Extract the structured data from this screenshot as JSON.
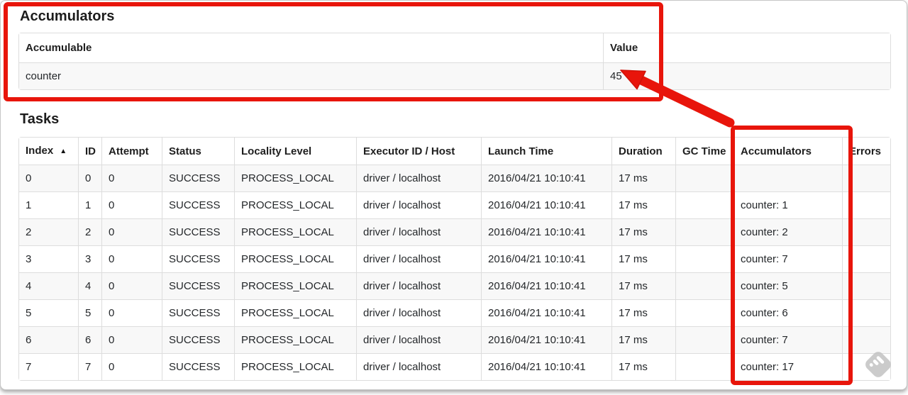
{
  "colors": {
    "highlight_red": "#e8150b",
    "stripe_grey": "#f8f8f8",
    "table_border": "#dddddd",
    "watermark_grey": "#c2c2c2"
  },
  "accumulators_section": {
    "title": "Accumulators",
    "headers": [
      "Accumulable",
      "Value"
    ],
    "rows": [
      {
        "accumulable": "counter",
        "value": "45"
      }
    ]
  },
  "tasks_section": {
    "title": "Tasks",
    "sort_indicator": "▲",
    "headers": [
      "Index",
      "ID",
      "Attempt",
      "Status",
      "Locality Level",
      "Executor ID / Host",
      "Launch Time",
      "Duration",
      "GC Time",
      "Accumulators",
      "Errors"
    ],
    "rows": [
      {
        "index": "0",
        "id": "0",
        "attempt": "0",
        "status": "SUCCESS",
        "locality_level": "PROCESS_LOCAL",
        "executor_id_host": "driver / localhost",
        "launch_time": "2016/04/21 10:10:41",
        "duration": "17 ms",
        "gc_time": "",
        "accumulators": "",
        "errors": ""
      },
      {
        "index": "1",
        "id": "1",
        "attempt": "0",
        "status": "SUCCESS",
        "locality_level": "PROCESS_LOCAL",
        "executor_id_host": "driver / localhost",
        "launch_time": "2016/04/21 10:10:41",
        "duration": "17 ms",
        "gc_time": "",
        "accumulators": "counter: 1",
        "errors": ""
      },
      {
        "index": "2",
        "id": "2",
        "attempt": "0",
        "status": "SUCCESS",
        "locality_level": "PROCESS_LOCAL",
        "executor_id_host": "driver / localhost",
        "launch_time": "2016/04/21 10:10:41",
        "duration": "17 ms",
        "gc_time": "",
        "accumulators": "counter: 2",
        "errors": ""
      },
      {
        "index": "3",
        "id": "3",
        "attempt": "0",
        "status": "SUCCESS",
        "locality_level": "PROCESS_LOCAL",
        "executor_id_host": "driver / localhost",
        "launch_time": "2016/04/21 10:10:41",
        "duration": "17 ms",
        "gc_time": "",
        "accumulators": "counter: 7",
        "errors": ""
      },
      {
        "index": "4",
        "id": "4",
        "attempt": "0",
        "status": "SUCCESS",
        "locality_level": "PROCESS_LOCAL",
        "executor_id_host": "driver / localhost",
        "launch_time": "2016/04/21 10:10:41",
        "duration": "17 ms",
        "gc_time": "",
        "accumulators": "counter: 5",
        "errors": ""
      },
      {
        "index": "5",
        "id": "5",
        "attempt": "0",
        "status": "SUCCESS",
        "locality_level": "PROCESS_LOCAL",
        "executor_id_host": "driver / localhost",
        "launch_time": "2016/04/21 10:10:41",
        "duration": "17 ms",
        "gc_time": "",
        "accumulators": "counter: 6",
        "errors": ""
      },
      {
        "index": "6",
        "id": "6",
        "attempt": "0",
        "status": "SUCCESS",
        "locality_level": "PROCESS_LOCAL",
        "executor_id_host": "driver / localhost",
        "launch_time": "2016/04/21 10:10:41",
        "duration": "17 ms",
        "gc_time": "",
        "accumulators": "counter: 7",
        "errors": ""
      },
      {
        "index": "7",
        "id": "7",
        "attempt": "0",
        "status": "SUCCESS",
        "locality_level": "PROCESS_LOCAL",
        "executor_id_host": "driver / localhost",
        "launch_time": "2016/04/21 10:10:41",
        "duration": "17 ms",
        "gc_time": "",
        "accumulators": "counter: 17",
        "errors": ""
      }
    ]
  },
  "annotations": {
    "accumulators_box": "highlight around Accumulators section",
    "column_box": "highlight around Accumulators task column",
    "arrow": "arrow from column box to accumulator value 45"
  },
  "watermark": {
    "icon": "feedly-logo"
  }
}
